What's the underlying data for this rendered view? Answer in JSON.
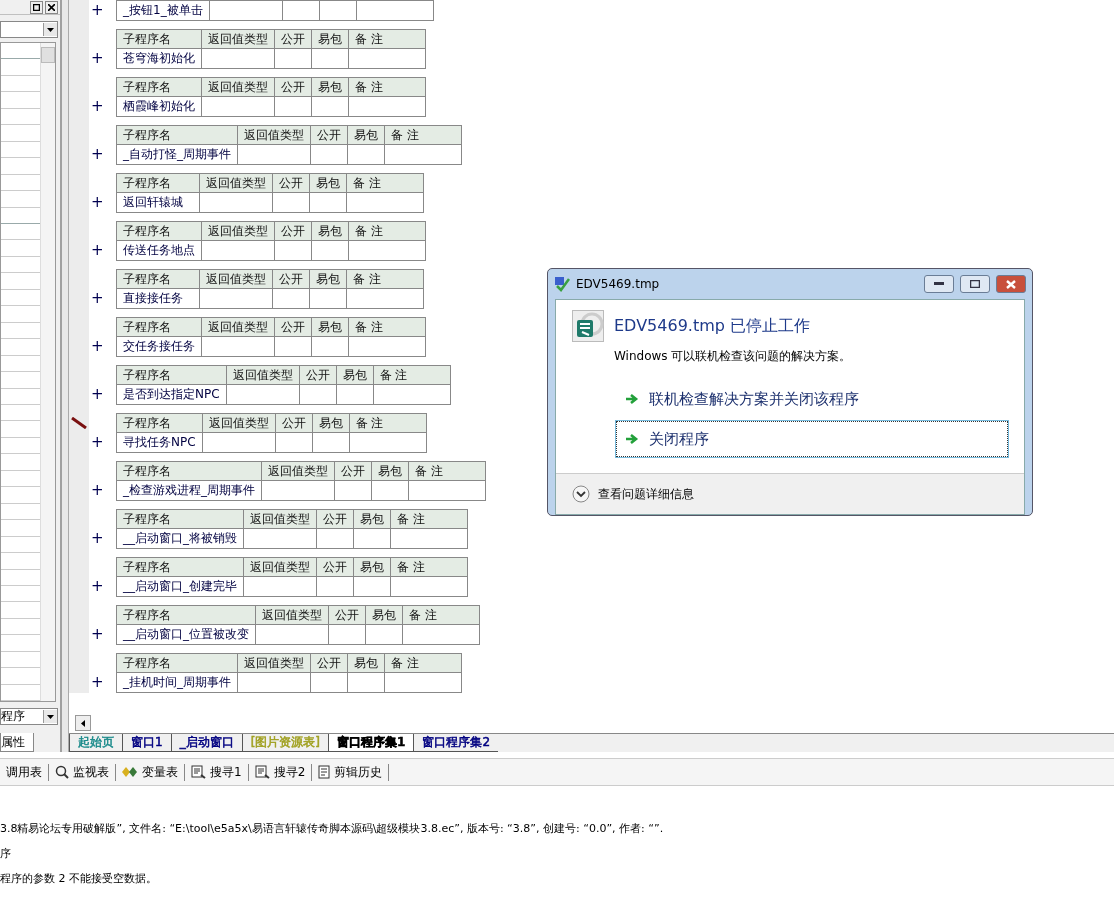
{
  "left_panel": {
    "selector_value": "程序",
    "tab": "属性"
  },
  "procedures": [
    {
      "name": "_按钮1_被单击",
      "marked": false
    },
    {
      "name": "苍穹海初始化",
      "marked": false,
      "columns": [
        "子程序名",
        "返回值类型",
        "公开",
        "易包",
        "备 注"
      ]
    },
    {
      "name": "栖霞峰初始化",
      "marked": false,
      "columns": [
        "子程序名",
        "返回值类型",
        "公开",
        "易包",
        "备 注"
      ]
    },
    {
      "name": "_自动打怪_周期事件",
      "marked": false,
      "columns": [
        "子程序名",
        "返回值类型",
        "公开",
        "易包",
        "备 注"
      ]
    },
    {
      "name": "返回轩辕城",
      "marked": false,
      "columns": [
        "子程序名",
        "返回值类型",
        "公开",
        "易包",
        "备 注"
      ]
    },
    {
      "name": "传送任务地点",
      "marked": false,
      "columns": [
        "子程序名",
        "返回值类型",
        "公开",
        "易包",
        "备 注"
      ]
    },
    {
      "name": "直接接任务",
      "marked": false,
      "columns": [
        "子程序名",
        "返回值类型",
        "公开",
        "易包",
        "备 注"
      ]
    },
    {
      "name": "交任务接任务",
      "marked": false,
      "columns": [
        "子程序名",
        "返回值类型",
        "公开",
        "易包",
        "备 注"
      ]
    },
    {
      "name": "是否到达指定NPC",
      "marked": false,
      "columns": [
        "子程序名",
        "返回值类型",
        "公开",
        "易包",
        "备 注"
      ]
    },
    {
      "name": "寻找任务NPC",
      "marked": true,
      "columns": [
        "子程序名",
        "返回值类型",
        "公开",
        "易包",
        "备 注"
      ]
    },
    {
      "name": "_检查游戏进程_周期事件",
      "marked": false,
      "columns": [
        "子程序名",
        "返回值类型",
        "公开",
        "易包",
        "备 注"
      ]
    },
    {
      "name": "__启动窗口_将被销毁",
      "marked": false,
      "columns": [
        "子程序名",
        "返回值类型",
        "公开",
        "易包",
        "备 注"
      ]
    },
    {
      "name": "__启动窗口_创建完毕",
      "marked": false,
      "columns": [
        "子程序名",
        "返回值类型",
        "公开",
        "易包",
        "备 注"
      ]
    },
    {
      "name": "__启动窗口_位置被改变",
      "marked": false,
      "columns": [
        "子程序名",
        "返回值类型",
        "公开",
        "易包",
        "备 注"
      ]
    },
    {
      "name": "_挂机时间_周期事件",
      "marked": false,
      "columns": [
        "子程序名",
        "返回值类型",
        "公开",
        "易包",
        "备 注"
      ]
    }
  ],
  "expand_mark": "+",
  "editor_tabs": [
    {
      "label": "起始页",
      "selected": false,
      "color": "#1a8a8a"
    },
    {
      "label": "窗口1",
      "selected": false,
      "color": "#000080"
    },
    {
      "label": "_启动窗口",
      "selected": false,
      "color": "#000080"
    },
    {
      "label": "[图片资源表]",
      "selected": false,
      "color": "#a0a020"
    },
    {
      "label": "窗口程序集1",
      "selected": true,
      "color": "#000000"
    },
    {
      "label": "窗口程序集2",
      "selected": false,
      "color": "#000080"
    }
  ],
  "tool_tabs": [
    {
      "label": "调用表",
      "kind": "none"
    },
    {
      "label": "监视表",
      "kind": "search"
    },
    {
      "label": "变量表",
      "kind": "vars"
    },
    {
      "label": "搜寻1",
      "kind": "find"
    },
    {
      "label": "搜寻2",
      "kind": "find"
    },
    {
      "label": "剪辑历史",
      "kind": "clip"
    }
  ],
  "output_lines": [
    "3.8精易论坛专用破解版”, 文件名: “E:\\tool\\e5a5x\\易语言轩辕传奇脚本源码\\超级模块3.8.ec”, 版本号: “3.8”, 创建号: “0.0”, 作者: “”.",
    "序",
    "程序的参数 2 不能接受空数据。"
  ],
  "dialog": {
    "title": "EDV5469.tmp",
    "heading": "EDV5469.tmp 已停止工作",
    "message": "Windows 可以联机检查该问题的解决方案。",
    "options": [
      {
        "label": "联机检查解决方案并关闭该程序",
        "selected": false
      },
      {
        "label": "关闭程序",
        "selected": true
      }
    ],
    "details": "查看问题详细信息"
  }
}
